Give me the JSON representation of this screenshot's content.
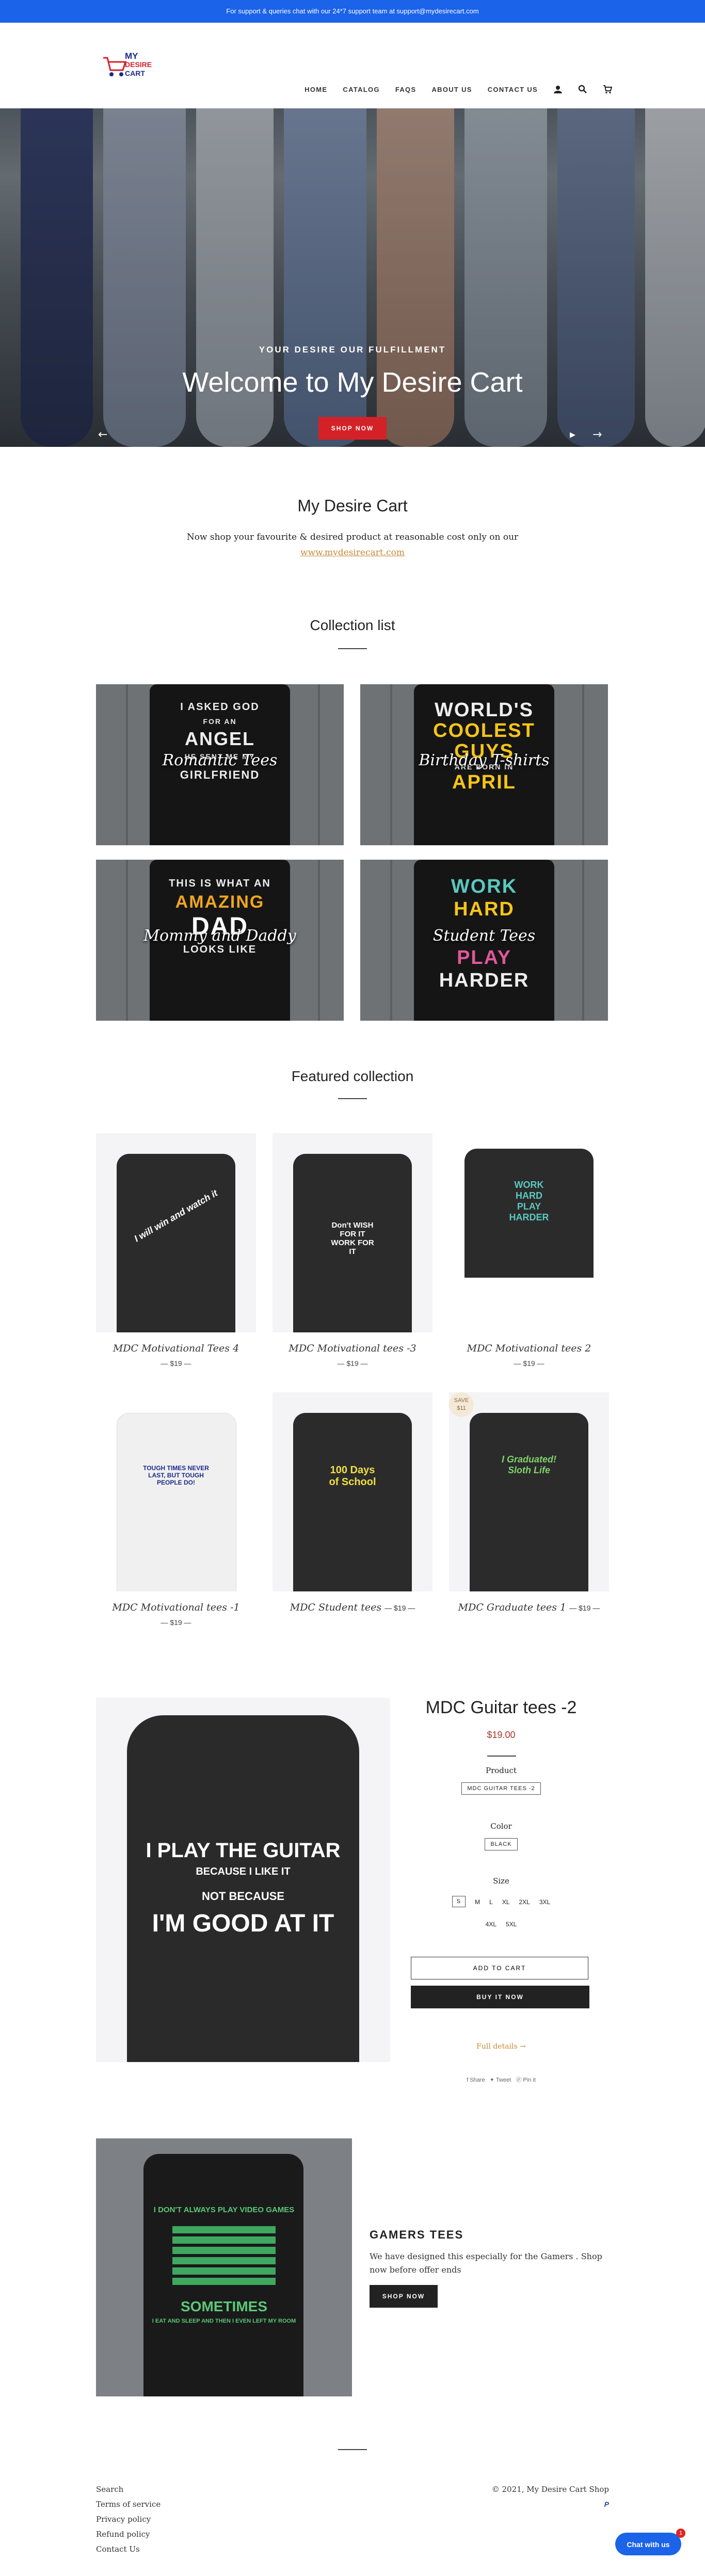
{
  "announcement": "For support & queries chat with our 24*7 support team at support@mydesirecart.com",
  "logo": {
    "line1": "MY",
    "line2": "DESIRE",
    "line3": "CART"
  },
  "nav": {
    "items": [
      "HOME",
      "CATALOG",
      "FAQS",
      "ABOUT US",
      "CONTACT US"
    ],
    "icons": [
      "account-icon",
      "search-icon",
      "cart-icon"
    ]
  },
  "hero": {
    "subheading": "YOUR DESIRE OUR FULFILLMENT",
    "title": "Welcome to My Desire Cart",
    "button": "SHOP NOW",
    "slide_count": 3,
    "active_slide": 1
  },
  "intro": {
    "heading": "My Desire Cart",
    "text": "Now shop your favourite & desired product at reasonable cost only on our",
    "link": "www.mydesirecart.com"
  },
  "collections": {
    "heading": "Collection list",
    "items": [
      {
        "title": "Romantic Tees",
        "art": [
          "I ASKED GOD",
          "FOR AN",
          "ANGEL",
          "HE SENT ME MY",
          "GIRLFRIEND"
        ]
      },
      {
        "title": "Birthday T-shirts",
        "art": [
          "WORLD'S",
          "COOLEST",
          "GUYS",
          "ARE BORN IN",
          "APRIL"
        ]
      },
      {
        "title": "Mommy and Daddy",
        "art": [
          "THIS IS WHAT AN",
          "AMAZING",
          "DAD",
          "LOOKS LIKE"
        ]
      },
      {
        "title": "Student Tees",
        "art": [
          "WORK",
          "HARD",
          "PLAY",
          "HARDER"
        ]
      }
    ]
  },
  "featured": {
    "heading": "Featured collection",
    "products": [
      {
        "name": "MDC Motivational Tees 4",
        "price": "$19",
        "print": "I will win and watch it"
      },
      {
        "name": "MDC Motivational tees -3",
        "price": "$19",
        "print": "Don't WISH FOR IT WORK FOR IT"
      },
      {
        "name": "MDC Motivational tees 2",
        "price": "$19",
        "print": "WORK HARD PLAY HARDER"
      },
      {
        "name": "MDC Motivational tees -1",
        "price": "$19",
        "print": "TOUGH TIMES NEVER LAST, BUT TOUGH PEOPLE DO!"
      },
      {
        "name": "MDC Student tees",
        "price": "$19",
        "print": "100 Days of School"
      },
      {
        "name": "MDC Graduate tees 1",
        "price": "$19",
        "print": "I Graduated! Sloth Life"
      }
    ],
    "sale_badge": "SAVE $11"
  },
  "product": {
    "title": "MDC Guitar tees -2",
    "price": "$19.00",
    "product_label": "Product",
    "product_value": "MDC GUITAR TEES -2",
    "color_label": "Color",
    "color_value": "BLACK",
    "size_label": "Size",
    "sizes_row1": [
      "S",
      "M",
      "L",
      "XL",
      "2XL",
      "3XL"
    ],
    "sizes_row2": [
      "4XL",
      "5XL"
    ],
    "add_to_cart": "ADD TO CART",
    "buy_now": "BUY IT NOW",
    "full_details": "Full details →",
    "share": [
      "Share",
      "Tweet",
      "Pin it"
    ],
    "print": [
      "I PLAY THE GUITAR",
      "BECAUSE I LIKE IT",
      "NOT BECAUSE",
      "I'M GOOD AT IT"
    ]
  },
  "gamers": {
    "heading": "GAMERS TEES",
    "text": "We have designed this especially for the Gamers . Shop now before offer ends",
    "button": "SHOP NOW",
    "print": [
      "I DON'T ALWAYS PLAY VIDEO GAMES",
      "SOMETIMES",
      "I EAT AND SLEEP AND THEN I EVEN LEFT MY ROOM"
    ]
  },
  "footer": {
    "links": [
      "Search",
      "Terms of service",
      "Privacy policy",
      "Refund policy",
      "Contact Us"
    ],
    "copyright": "© 2021, My Desire Cart Shop",
    "payment_icon": "paypal-icon"
  },
  "chat": {
    "label": "Chat with us",
    "badge": "1"
  },
  "colors": {
    "announce": "#1b63e8",
    "accent": "#d42128",
    "link": "#c68a3a"
  }
}
